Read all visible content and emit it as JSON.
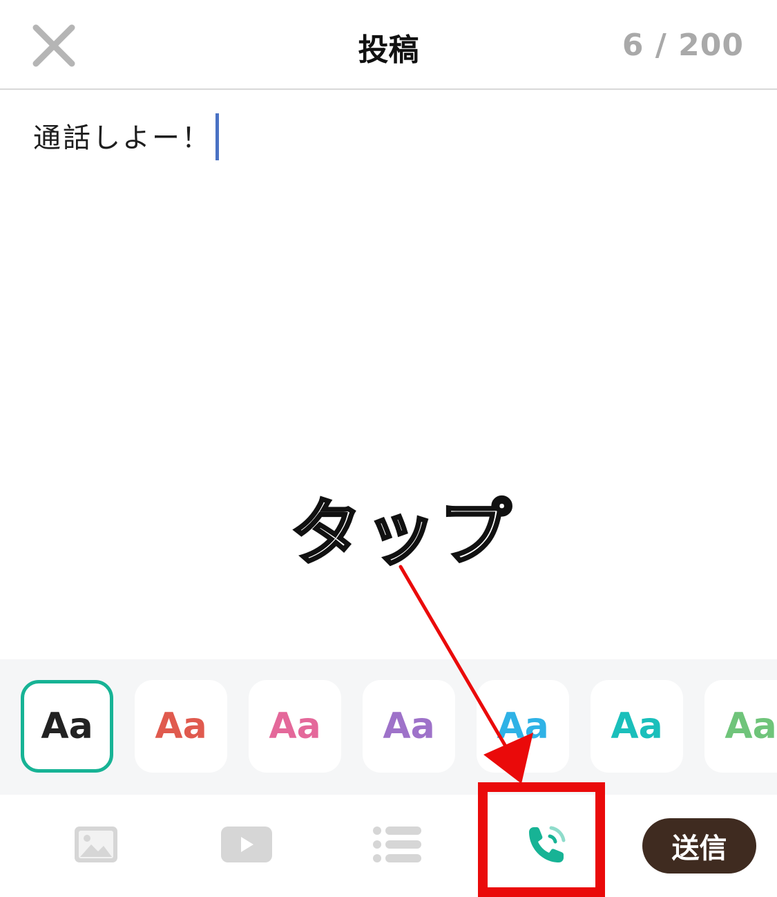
{
  "header": {
    "title": "投稿",
    "counter": "6 / 200"
  },
  "editor": {
    "text": "通話しよー！"
  },
  "annotation": {
    "label": "タップ"
  },
  "font_styles": {
    "items": [
      {
        "label": "Aa",
        "color": "#222222",
        "selected": true
      },
      {
        "label": "Aa",
        "color": "#e05a4e"
      },
      {
        "label": "Aa",
        "color": "#e4689a"
      },
      {
        "label": "Aa",
        "color": "#9e72c9"
      },
      {
        "label": "Aa",
        "color": "#2fb2e6"
      },
      {
        "label": "Aa",
        "color": "#1abfbb"
      },
      {
        "label": "Aa",
        "color": "#6fc47a"
      }
    ]
  },
  "toolbar": {
    "icons": [
      "image-icon",
      "video-icon",
      "list-icon",
      "call-icon"
    ],
    "send_label": "送信"
  },
  "colors": {
    "accent": "#17b395",
    "send_button": "#3f2b20",
    "highlight": "#ea0a0a",
    "caret": "#4a72c4"
  }
}
